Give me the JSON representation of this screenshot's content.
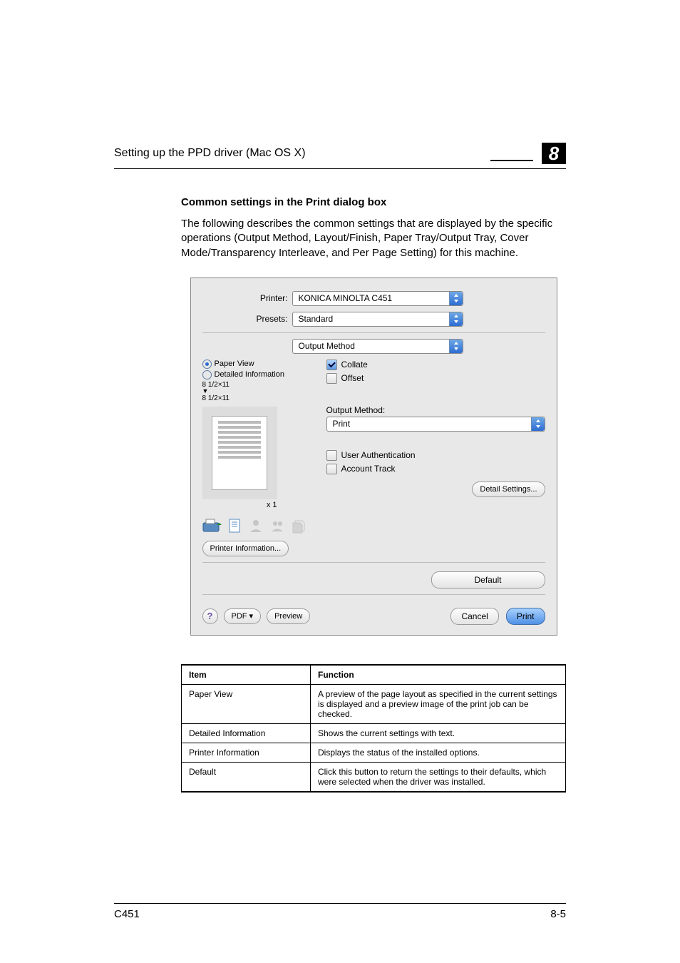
{
  "header": {
    "running_title": "Setting up the PPD driver (Mac OS X)",
    "chapter_number": "8"
  },
  "section": {
    "heading": "Common settings in the Print dialog box",
    "intro": "The following describes the common settings that are displayed by the specific operations (Output Method, Layout/Finish, Paper Tray/Output Tray, Cover Mode/Transparency Interleave, and Per Page Setting) for this machine."
  },
  "dialog": {
    "printer_label": "Printer:",
    "printer_value": "KONICA MINOLTA C451",
    "presets_label": "Presets:",
    "presets_value": "Standard",
    "panel_value": "Output Method",
    "radio_paper_view": "Paper View",
    "radio_detailed": "Detailed Information",
    "paper_size_top": "8 1/2×11",
    "paper_size_bottom": "8 1/2×11",
    "preview_count": "x 1",
    "collate": "Collate",
    "offset": "Offset",
    "output_method_label": "Output Method:",
    "output_method_value": "Print",
    "user_auth": "User Authentication",
    "account_track": "Account Track",
    "printer_info_btn": "Printer Information...",
    "detail_settings_btn": "Detail Settings...",
    "default_btn": "Default",
    "help": "?",
    "pdf_btn": "PDF ▾",
    "preview_btn": "Preview",
    "cancel_btn": "Cancel",
    "print_btn": "Print"
  },
  "table": {
    "headers": {
      "item": "Item",
      "function": "Function"
    },
    "rows": [
      {
        "item": "Paper View",
        "function": "A preview of the page layout as specified in the current settings is displayed and a preview image of the print job can be checked."
      },
      {
        "item": "Detailed Information",
        "function": "Shows the current settings with text."
      },
      {
        "item": "Printer Information",
        "function": "Displays the status of the installed options."
      },
      {
        "item": "Default",
        "function": "Click this button to return the settings to their defaults, which were selected when the driver was installed."
      }
    ]
  },
  "footer": {
    "model": "C451",
    "page": "8-5"
  }
}
